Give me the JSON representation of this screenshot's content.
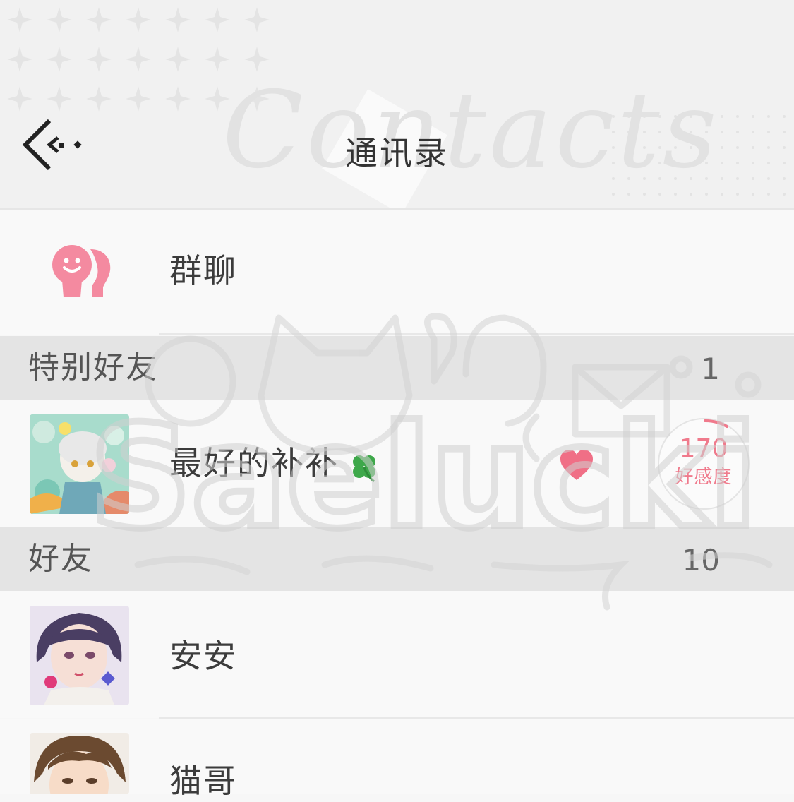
{
  "header": {
    "title": "通讯录",
    "deco_text": "Contacts",
    "back_icon": "back-arrow-icon"
  },
  "group_chat": {
    "label": "群聊",
    "icon": "group-chat-icon",
    "accent": "#f48aa0"
  },
  "sections": {
    "special": {
      "label": "特别好友",
      "count": "1"
    },
    "friends": {
      "label": "好友",
      "count": "10"
    }
  },
  "special_friends": [
    {
      "name": "最好的补补",
      "badge_icon": "clover-icon",
      "favorite_icon": "heart-icon",
      "affinity": {
        "value": "170",
        "label": "好感度"
      }
    }
  ],
  "friends": [
    {
      "name": "安安"
    },
    {
      "name": "猫哥"
    }
  ],
  "watermark": "Saelucki",
  "colors": {
    "pink": "#f07a8c",
    "heart": "#f06f86",
    "clover": "#3ea84a",
    "section_bg": "#e4e4e4"
  }
}
